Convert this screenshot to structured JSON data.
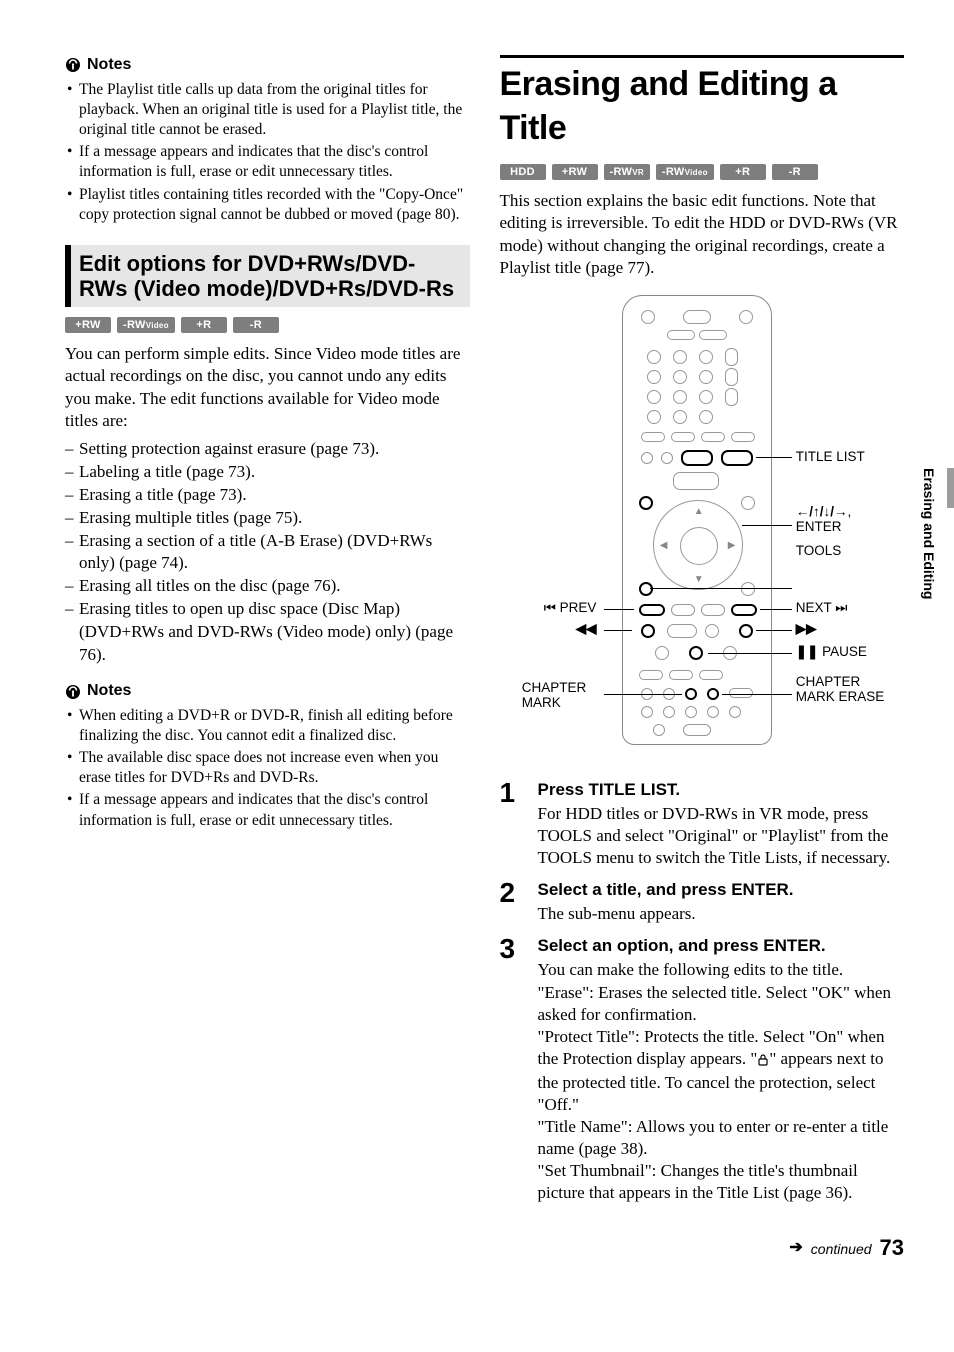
{
  "left": {
    "notesLabel1": "Notes",
    "notes1": [
      "The Playlist title calls up data from the original titles for playback. When an original title is used for a Playlist title, the original title cannot be erased.",
      "If a message appears and indicates that the disc's control information is full, erase or edit unnecessary titles.",
      "Playlist titles containing titles recorded with the \"Copy-Once\" copy protection signal cannot be dubbed or moved (page 80)."
    ],
    "sectionTitle": "Edit options for DVD+RWs/DVD-RWs (Video mode)/DVD+Rs/DVD-Rs",
    "badges": [
      "+RW",
      "-RWVideo",
      "+R",
      "-R"
    ],
    "intro": "You can perform simple edits. Since Video mode titles are actual recordings on the disc, you cannot undo any edits you make. The edit functions available for Video mode titles are:",
    "dash": [
      "Setting protection against erasure (page 73).",
      "Labeling a title (page 73).",
      "Erasing a title (page 73).",
      "Erasing multiple titles (page 75).",
      "Erasing a section of a title (A-B Erase) (DVD+RWs only) (page 74).",
      "Erasing all titles on the disc (page 76).",
      "Erasing titles to open up disc space (Disc Map) (DVD+RWs and DVD-RWs (Video mode) only) (page 76)."
    ],
    "notesLabel2": "Notes",
    "notes2": [
      "When editing a DVD+R or DVD-R, finish all editing before finalizing the disc. You cannot edit a finalized disc.",
      "The available disc space does not increase even when you erase titles for DVD+Rs and DVD-Rs.",
      "If a message appears and indicates that the disc's control information is full, erase or edit unnecessary titles."
    ]
  },
  "right": {
    "title": "Erasing and Editing a Title",
    "badges": [
      "HDD",
      "+RW",
      "-RWVR",
      "-RWVideo",
      "+R",
      "-R"
    ],
    "intro": "This section explains the basic edit functions. Note that editing is irreversible. To edit the HDD or DVD-RWs (VR mode) without changing the original recordings, create a Playlist title (page 77).",
    "remoteLabels": {
      "titleList": "TITLE LIST",
      "arrowsEnter": "←/↑/↓/→, ENTER",
      "tools": "TOOLS",
      "prev": "PREV",
      "next": "NEXT",
      "pause": " PAUSE",
      "chapterMark": "CHAPTER MARK",
      "chapterMarkErase": "CHAPTER MARK ERASE",
      "rew": "◀◀",
      "ff": "▶▶",
      "prevSym": "⏮",
      "nextSym": "⏭",
      "pauseSym": "❚❚"
    },
    "steps": [
      {
        "n": "1",
        "head": "Press TITLE LIST.",
        "body": "For HDD titles or DVD-RWs in VR mode, press TOOLS and select \"Original\" or \"Playlist\" from the TOOLS menu to switch the Title Lists, if necessary."
      },
      {
        "n": "2",
        "head": "Select a title, and press ENTER.",
        "body": "The sub-menu appears."
      },
      {
        "n": "3",
        "head": "Select an option, and press ENTER.",
        "body": "You can make the following edits to the title. \"Erase\": Erases the selected title. Select \"OK\" when asked for confirmation. \"Protect Title\": Protects the title. Select \"On\" when the Protection display appears. \" 🔒 \" appears next to the protected title. To cancel the protection, select \"Off.\" \"Title Name\": Allows you to enter or re-enter a title name (page 38). \"Set Thumbnail\": Changes the title's thumbnail picture that appears in the Title List (page 36)."
      }
    ]
  },
  "sideTab": "Erasing and Editing",
  "footer": {
    "continued": "continued",
    "page": "73"
  }
}
